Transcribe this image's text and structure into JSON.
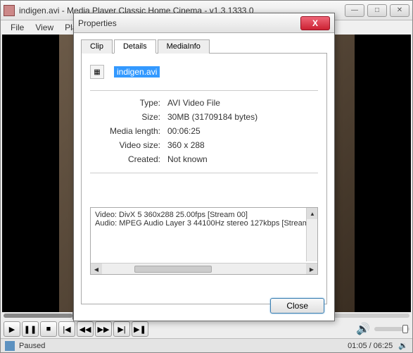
{
  "window": {
    "title": "indigen.avi - Media Player Classic Home Cinema - v1.3.1333.0",
    "menu": {
      "file": "File",
      "view": "View",
      "play": "Pla"
    }
  },
  "player": {
    "time_display": "01:05 / 06:25",
    "status": "Paused"
  },
  "dialog": {
    "title": "Properties",
    "tabs": {
      "clip": "Clip",
      "details": "Details",
      "mediainfo": "MediaInfo"
    },
    "filename": "indigen.avi",
    "props": {
      "type_label": "Type:",
      "type_value": "AVI Video File",
      "size_label": "Size:",
      "size_value": "30MB (31709184 bytes)",
      "length_label": "Media length:",
      "length_value": "00:06:25",
      "videosize_label": "Video size:",
      "videosize_value": "360 x 288",
      "created_label": "Created:",
      "created_value": "Not known"
    },
    "streams": {
      "video": "Video: DivX 5 360x288 25.00fps [Stream 00]",
      "audio": "Audio: MPEG Audio Layer 3 44100Hz stereo 127kbps [Stream"
    },
    "close": "Close"
  }
}
